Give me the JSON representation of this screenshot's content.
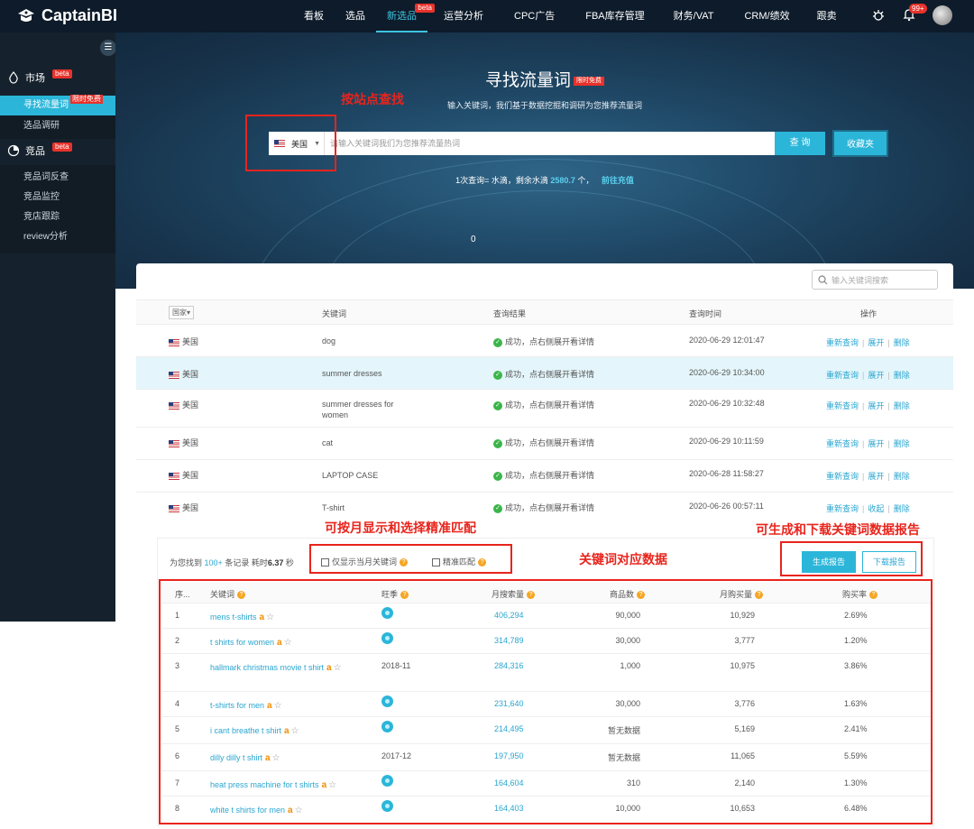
{
  "brand": {
    "name": "CaptainBI"
  },
  "nav": {
    "items": [
      {
        "label": "看板"
      },
      {
        "label": "选品"
      },
      {
        "label": "新选品",
        "badge": "beta",
        "active": true
      },
      {
        "label": "运营分析"
      },
      {
        "label": "CPC广告"
      },
      {
        "label": "FBA库存管理"
      },
      {
        "label": "财务/VAT"
      },
      {
        "label": "CRM/绩效"
      },
      {
        "label": "跟卖"
      }
    ],
    "notification_count": "99+"
  },
  "sidebar": {
    "group_market": {
      "label": "市场",
      "badge": "beta"
    },
    "market_items": [
      {
        "label": "寻找流量词",
        "badge": "限时免费",
        "active": true
      },
      {
        "label": "选品调研"
      }
    ],
    "group_competitor": {
      "label": "竞品",
      "badge": "beta"
    },
    "competitor_items": [
      {
        "label": "竞品词反查"
      },
      {
        "label": "竞品监控"
      },
      {
        "label": "竞店跟踪"
      },
      {
        "label": "review分析"
      }
    ]
  },
  "hero": {
    "title": "寻找流量词",
    "title_badge": "限时免费",
    "subtitle": "输入关键词，我们基于数据挖掘和调研为您推荐流量词",
    "country": "美国",
    "search_placeholder": "请输入关键词我们为您推荐流量热词",
    "search_button": "查 询",
    "fav_button": "收藏夹",
    "quota_prefix": "1次查询=  水滴，剩余水滴",
    "quota_value": "2580.7",
    "quota_unit": "个，",
    "quota_link": "前往充值",
    "counter": "0"
  },
  "history": {
    "search_placeholder": "输入关键词搜索",
    "headers": {
      "country": "国家",
      "keyword": "关键词",
      "result": "查询结果",
      "time": "查询时间",
      "action": "操作"
    },
    "rows": [
      {
        "country": "美国",
        "keyword": "dog",
        "result": "成功，点右侧展开看详情",
        "time": "2020-06-29 12:01:47",
        "a1": "重新查询",
        "a2": "展开",
        "a3": "删除"
      },
      {
        "country": "美国",
        "keyword": "summer dresses",
        "result": "成功，点右侧展开看详情",
        "time": "2020-06-29 10:34:00",
        "a1": "重新查询",
        "a2": "展开",
        "a3": "删除"
      },
      {
        "country": "美国",
        "keyword": "summer dresses for women",
        "result": "成功，点右侧展开看详情",
        "time": "2020-06-29 10:32:48",
        "a1": "重新查询",
        "a2": "展开",
        "a3": "删除"
      },
      {
        "country": "美国",
        "keyword": "cat",
        "result": "成功，点右侧展开看详情",
        "time": "2020-06-29 10:11:59",
        "a1": "重新查询",
        "a2": "展开",
        "a3": "删除"
      },
      {
        "country": "美国",
        "keyword": "LAPTOP CASE",
        "result": "成功，点右侧展开看详情",
        "time": "2020-06-28 11:58:27",
        "a1": "重新查询",
        "a2": "展开",
        "a3": "删除"
      },
      {
        "country": "美国",
        "keyword": "T-shirt",
        "result": "成功，点右侧展开看详情",
        "time": "2020-06-26 00:57:11",
        "a1": "重新查询",
        "a2": "收起",
        "a3": "删除"
      }
    ]
  },
  "results": {
    "found_prefix": "为您找到",
    "found_count": "100+",
    "found_mid": "条记录 耗时",
    "found_time": "6.37",
    "found_suffix": "秒",
    "opt_month": "仅显示当月关键词",
    "opt_exact": "精准匹配",
    "btn_generate": "生成报告",
    "btn_download": "下载报告",
    "headers": {
      "idx": "序...",
      "keyword": "关键词",
      "season": "旺季",
      "search": "月搜索量",
      "products": "商品数",
      "purchase": "月购买量",
      "rate": "购买率"
    },
    "rows": [
      {
        "idx": "1",
        "keyword": "mens t-shirts",
        "season": "",
        "search": "406,294",
        "products": "90,000",
        "purchase": "10,929",
        "rate": "2.69%"
      },
      {
        "idx": "2",
        "keyword": "t shirts for women",
        "season": "",
        "search": "314,789",
        "products": "30,000",
        "purchase": "3,777",
        "rate": "1.20%"
      },
      {
        "idx": "3",
        "keyword": "hallmark christmas movie t shirt",
        "season": "2018-11",
        "search": "284,316",
        "products": "1,000",
        "purchase": "10,975",
        "rate": "3.86%"
      },
      {
        "idx": "4",
        "keyword": "t-shirts for men",
        "season": "",
        "search": "231,640",
        "products": "30,000",
        "purchase": "3,776",
        "rate": "1.63%"
      },
      {
        "idx": "5",
        "keyword": "i cant breathe t shirt",
        "season": "",
        "search": "214,495",
        "products": "暂无数据",
        "purchase": "5,169",
        "rate": "2.41%"
      },
      {
        "idx": "6",
        "keyword": "dilly dilly t shirt",
        "season": "2017-12",
        "search": "197,950",
        "products": "暂无数据",
        "purchase": "11,065",
        "rate": "5.59%"
      },
      {
        "idx": "7",
        "keyword": "heat press machine for t shirts",
        "season": "",
        "search": "164,604",
        "products": "310",
        "purchase": "2,140",
        "rate": "1.30%"
      },
      {
        "idx": "8",
        "keyword": "white t shirts for men",
        "season": "",
        "search": "164,403",
        "products": "10,000",
        "purchase": "10,653",
        "rate": "6.48%"
      }
    ]
  },
  "annotations": {
    "by_site": "按站点查找",
    "month_exact": "可按月显示和选择精准匹配",
    "keyword_data": "关键词对应数据",
    "report": "可生成和下载关键词数据报告"
  },
  "colors": {
    "accent": "#2bb6d9",
    "nav_bg": "#0d1b2a",
    "sidebar_bg": "#15222d",
    "badge_red": "#e8322b",
    "annotation_red": "#e8241c"
  }
}
